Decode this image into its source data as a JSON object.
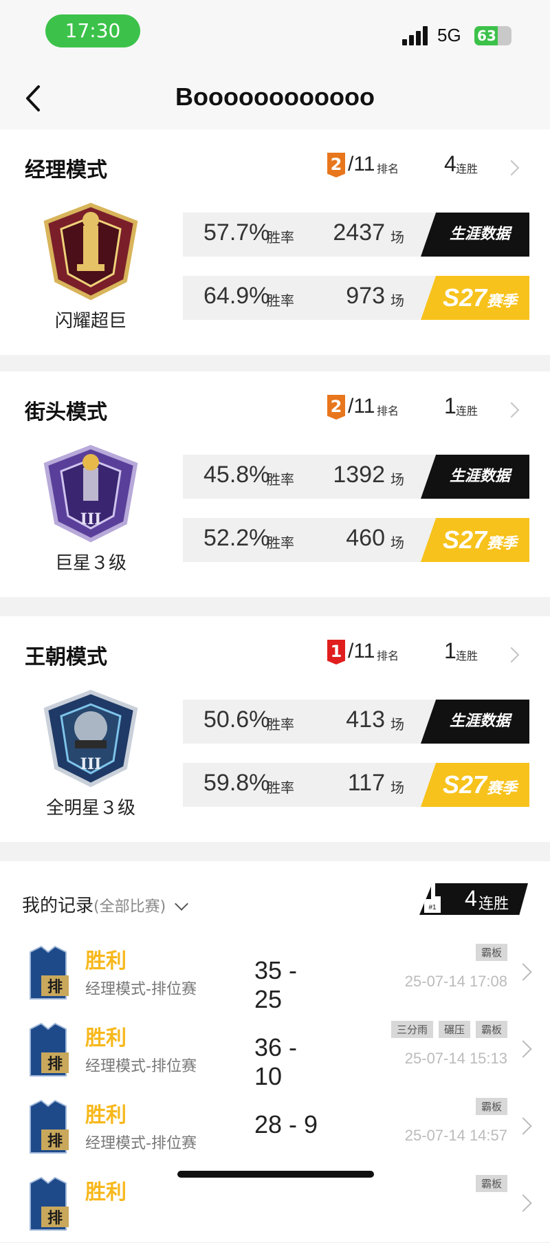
{
  "status_bar": {
    "time": "17:30",
    "network": "5G",
    "battery": "63",
    "battery_level": 0.63
  },
  "header": {
    "title": "Boooooooooooo"
  },
  "modes": [
    {
      "name": "经理模式",
      "rank": "2",
      "rank_total": "/11",
      "rank_label": "排名",
      "rank_color": "#e8761c",
      "streak": "4",
      "streak_label": "连胜",
      "tier": "闪耀超巨",
      "career": {
        "pct": "57.7%",
        "pct_label": "胜率",
        "games": "2437",
        "games_label": "场",
        "button": "生涯数据"
      },
      "season": {
        "pct": "64.9%",
        "pct_label": "胜率",
        "games": "973",
        "games_label": "场",
        "button_s": "S27",
        "button_t": "赛季"
      }
    },
    {
      "name": "街头模式",
      "rank": "2",
      "rank_total": "/11",
      "rank_label": "排名",
      "rank_color": "#e8761c",
      "streak": "1",
      "streak_label": "连胜",
      "tier": "巨星３级",
      "career": {
        "pct": "45.8%",
        "pct_label": "胜率",
        "games": "1392",
        "games_label": "场",
        "button": "生涯数据"
      },
      "season": {
        "pct": "52.2%",
        "pct_label": "胜率",
        "games": "460",
        "games_label": "场",
        "button_s": "S27",
        "button_t": "赛季"
      }
    },
    {
      "name": "王朝模式",
      "rank": "1",
      "rank_total": "/11",
      "rank_label": "排名",
      "rank_color": "#e01e1e",
      "streak": "1",
      "streak_label": "连胜",
      "tier": "全明星３级",
      "career": {
        "pct": "50.6%",
        "pct_label": "胜率",
        "games": "413",
        "games_label": "场",
        "button": "生涯数据"
      },
      "season": {
        "pct": "59.8%",
        "pct_label": "胜率",
        "games": "117",
        "games_label": "场",
        "button_s": "S27",
        "button_t": "赛季"
      }
    }
  ],
  "records": {
    "title": "我的记录",
    "filter": "(全部比赛)",
    "streak_num": "4",
    "streak_label": "连胜",
    "items": [
      {
        "result": "胜利",
        "mode": "经理模式-排位赛",
        "score": "35 - 25",
        "tags": [
          "霸板"
        ],
        "date": "25-07-14 17:08",
        "icon_text": "排"
      },
      {
        "result": "胜利",
        "mode": "经理模式-排位赛",
        "score": "36 - 10",
        "tags": [
          "三分雨",
          "碾压",
          "霸板"
        ],
        "date": "25-07-14 15:13",
        "icon_text": "排"
      },
      {
        "result": "胜利",
        "mode": "经理模式-排位赛",
        "score": "28 - 9",
        "tags": [
          "霸板"
        ],
        "date": "25-07-14 14:57",
        "icon_text": "排"
      },
      {
        "result": "胜利",
        "mode": "",
        "score": "",
        "tags": [
          "霸板"
        ],
        "date": "",
        "icon_text": "排"
      }
    ]
  }
}
